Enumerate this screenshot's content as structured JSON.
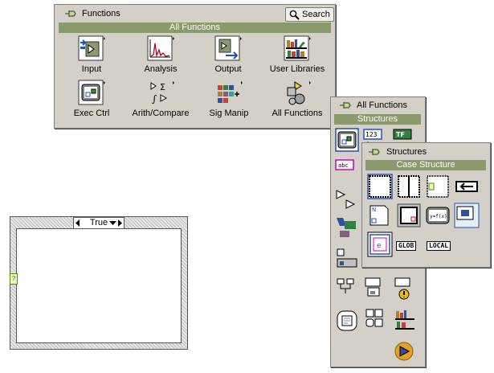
{
  "functions_palette": {
    "title": "Functions",
    "search_label": "Search",
    "category": "All Functions",
    "items": [
      {
        "label": "Input",
        "icon": "input-icon"
      },
      {
        "label": "Analysis",
        "icon": "analysis-icon"
      },
      {
        "label": "Output",
        "icon": "output-icon"
      },
      {
        "label": "User Libraries",
        "icon": "user-libraries-icon"
      },
      {
        "label": "Exec Ctrl",
        "icon": "exec-ctrl-icon"
      },
      {
        "label": "Arith/Compare",
        "icon": "arith-compare-icon"
      },
      {
        "label": "Sig Manip",
        "icon": "sig-manip-icon"
      },
      {
        "label": "All Functions",
        "icon": "all-functions-icon"
      }
    ]
  },
  "all_functions_palette": {
    "title": "All Functions",
    "category": "Structures",
    "labels": {
      "numeric": "123",
      "boolean": "TF",
      "string": "abc"
    }
  },
  "structures_palette": {
    "title": "Structures",
    "category": "Case Structure",
    "labels": {
      "glob": "GLOB",
      "local": "LOCAL",
      "formula": "y=f(x)",
      "event": "e"
    }
  },
  "case_structure": {
    "selector_value": "True",
    "tunnel_glyph": "?"
  }
}
